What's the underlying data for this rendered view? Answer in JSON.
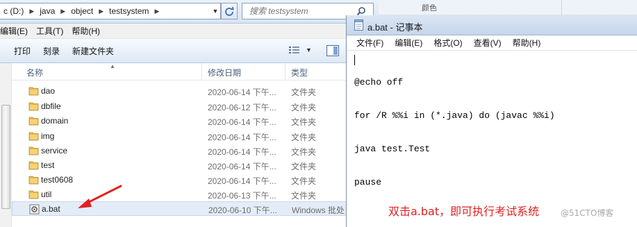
{
  "explorer": {
    "breadcrumb": [
      "c (D:)",
      "java",
      "object",
      "testsystem"
    ],
    "search_placeholder": "搜索 testsystem",
    "menu": [
      "编辑(E)",
      "工具(T)",
      "帮助(H)"
    ],
    "toolbar": [
      "打印",
      "刻录",
      "新建文件夹"
    ],
    "columns": {
      "name": "名称",
      "date": "修改日期",
      "type": "类型"
    },
    "files": [
      {
        "name": "dao",
        "date": "2020-06-14 下午...",
        "type": "文件夹",
        "icon": "folder-icon"
      },
      {
        "name": "dbfile",
        "date": "2020-06-12 下午...",
        "type": "文件夹",
        "icon": "folder-icon"
      },
      {
        "name": "domain",
        "date": "2020-06-14 下午...",
        "type": "文件夹",
        "icon": "folder-icon"
      },
      {
        "name": "img",
        "date": "2020-06-14 下午...",
        "type": "文件夹",
        "icon": "folder-icon"
      },
      {
        "name": "service",
        "date": "2020-06-14 下午...",
        "type": "文件夹",
        "icon": "folder-icon"
      },
      {
        "name": "test",
        "date": "2020-06-14 下午...",
        "type": "文件夹",
        "icon": "folder-icon"
      },
      {
        "name": "test0608",
        "date": "2020-06-14 下午...",
        "type": "文件夹",
        "icon": "folder-icon"
      },
      {
        "name": "util",
        "date": "2020-06-13 下午...",
        "type": "文件夹",
        "icon": "folder-icon"
      },
      {
        "name": "a.bat",
        "date": "2020-06-10 下午...",
        "type": "Windows 批处",
        "icon": "batch-file-icon"
      }
    ]
  },
  "background": {
    "color_label": "颜色"
  },
  "notepad": {
    "title": "a.bat - 记事本",
    "menu": [
      "文件(F)",
      "编辑(E)",
      "格式(O)",
      "查看(V)",
      "帮助(H)"
    ],
    "content_lines": [
      "@echo off",
      "for /R %%i in (*.java) do (javac %%i)",
      "java test.Test",
      "pause"
    ]
  },
  "annotation": "双击a.bat，即可执行考试系统",
  "watermark": "@51CTO博客",
  "colors": {
    "annotation": "#e02020",
    "selected_row": "#e4ecf7",
    "folder": "#e8b84a"
  }
}
